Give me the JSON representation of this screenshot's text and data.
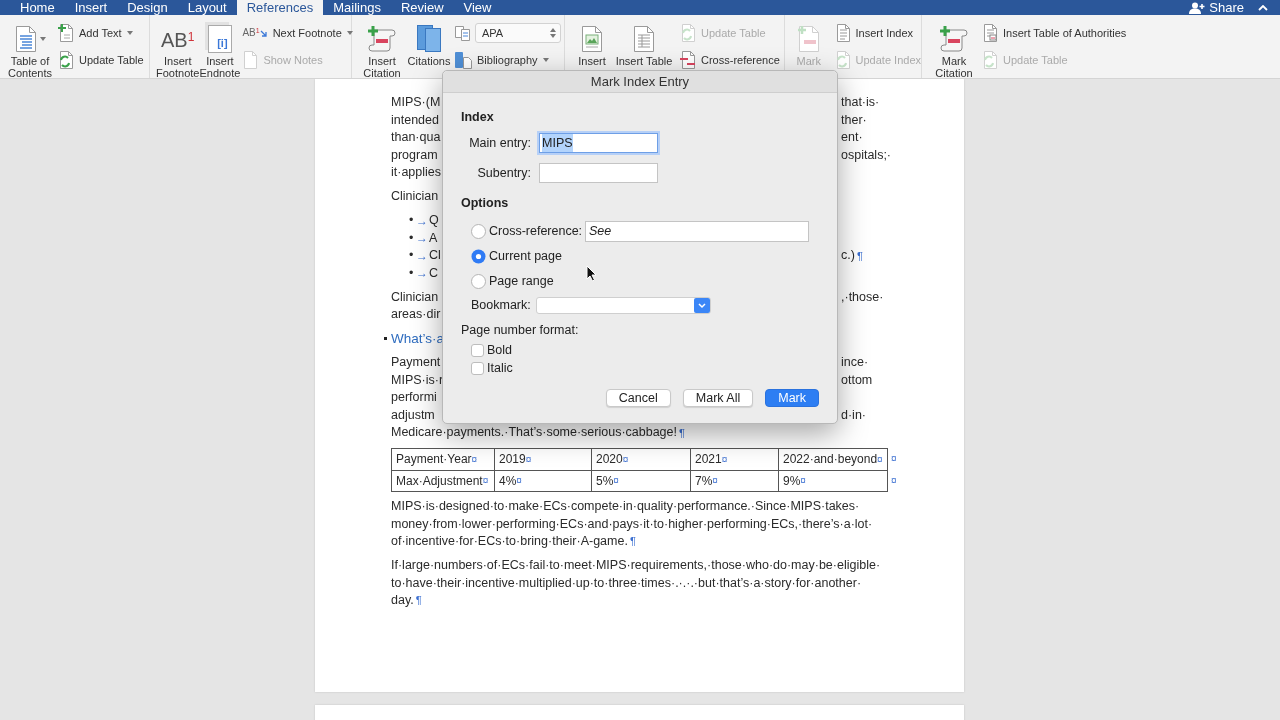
{
  "tabs": [
    {
      "label": "Home",
      "selected": false
    },
    {
      "label": "Insert",
      "selected": false
    },
    {
      "label": "Design",
      "selected": false
    },
    {
      "label": "Layout",
      "selected": false
    },
    {
      "label": "References",
      "selected": true
    },
    {
      "label": "Mailings",
      "selected": false
    },
    {
      "label": "Review",
      "selected": false
    },
    {
      "label": "View",
      "selected": false
    }
  ],
  "share": {
    "label": "Share"
  },
  "ribbon": [
    {
      "large": [
        {
          "lines": [
            "Table of",
            "Contents"
          ],
          "dropdown": true,
          "disabled": false
        }
      ],
      "small": [
        {
          "kind": "button",
          "label": "Add Text",
          "dropdown": true,
          "disabled": false
        },
        {
          "kind": "button",
          "label": "Update Table",
          "dropdown": false,
          "disabled": false
        }
      ]
    },
    {
      "large": [
        {
          "lines": [
            "Insert",
            "Footnote"
          ],
          "glyph": "AB",
          "glyph_sup": "1",
          "dropdown": false,
          "disabled": false
        },
        {
          "lines": [
            "Insert",
            "Endnote"
          ],
          "glyph": "[i]",
          "dropdown": false,
          "disabled": false
        }
      ],
      "small": [
        {
          "kind": "button",
          "label": "Next Footnote",
          "glyph": "AB",
          "glyph_sup": "1",
          "dropdown": true,
          "disabled": false
        },
        {
          "kind": "button",
          "label": "Show Notes",
          "dropdown": false,
          "disabled": true
        }
      ]
    },
    {
      "large": [
        {
          "lines": [
            "Insert",
            "Citation"
          ],
          "dropdown": false,
          "disabled": false
        },
        {
          "lines": [
            "Citations"
          ],
          "dropdown": false,
          "disabled": false
        }
      ],
      "small": [
        {
          "kind": "select",
          "value": "APA",
          "dropdown": false,
          "disabled": false
        },
        {
          "kind": "button",
          "label": "Bibliography",
          "dropdown": true,
          "disabled": false
        }
      ]
    },
    {
      "large": [
        {
          "lines": [
            "Insert"
          ],
          "dropdown": false,
          "disabled": false
        },
        {
          "lines": [
            "Insert Table"
          ],
          "dropdown": false,
          "disabled": false
        }
      ],
      "small": [
        {
          "kind": "button",
          "label": "Update Table",
          "dropdown": false,
          "disabled": true
        },
        {
          "kind": "button",
          "label": "Cross-reference",
          "dropdown": false,
          "disabled": false
        }
      ]
    },
    {
      "large": [
        {
          "lines": [
            "Mark"
          ],
          "dropdown": false,
          "disabled": true
        }
      ],
      "small": [
        {
          "kind": "button",
          "label": "Insert Index",
          "dropdown": false,
          "disabled": false
        },
        {
          "kind": "button",
          "label": "Update Index",
          "dropdown": false,
          "disabled": true
        }
      ]
    },
    {
      "large": [
        {
          "lines": [
            "Mark",
            "Citation"
          ],
          "dropdown": false,
          "disabled": false
        }
      ],
      "small": [
        {
          "kind": "button",
          "label": "Insert Table of Authorities",
          "dropdown": false,
          "disabled": false
        },
        {
          "kind": "button",
          "label": "Update Table",
          "dropdown": false,
          "disabled": true
        }
      ]
    }
  ],
  "document": {
    "blocks": [
      {
        "kind": "fragment",
        "lines": [
          {
            "left": "MIPS·(M",
            "right": "that·is·"
          },
          {
            "left": "intended",
            "right": "ther·"
          },
          {
            "left": "than·qua",
            "right": "ent·"
          },
          {
            "left": "program",
            "right": "ospitals;·"
          },
          {
            "left": "it·applies"
          }
        ]
      },
      {
        "kind": "fragment",
        "lines": [
          {
            "left": "Clinician"
          }
        ]
      },
      {
        "kind": "bullets",
        "items": [
          {
            "bullet": "•",
            "tab": "→",
            "left": "Q"
          },
          {
            "bullet": "•",
            "tab": "→",
            "left": "A"
          },
          {
            "bullet": "•",
            "tab": "→",
            "left": "Cl",
            "right": "c.)",
            "mark": "¶"
          },
          {
            "bullet": "•",
            "tab": "→",
            "left": "C"
          }
        ]
      },
      {
        "kind": "fragment",
        "lines": [
          {
            "left": "Clinician",
            "right": ",·those·"
          },
          {
            "left": "areas·dir"
          }
        ]
      },
      {
        "kind": "heading",
        "lines": [
          {
            "left": "What’s·a"
          }
        ]
      },
      {
        "kind": "fragment",
        "lines": [
          {
            "left": "Payment",
            "right": "ince·"
          },
          {
            "left": "MIPS·is·r",
            "right": "ottom"
          },
          {
            "left": "performi"
          },
          {
            "left": "adjustm",
            "right": "d·in·"
          },
          {
            "left": "Medicare·payments.·That’s·some·serious·cabbage!",
            "mark": "¶"
          }
        ]
      },
      {
        "kind": "table",
        "rows": [
          {
            "cells": [
              {
                "text": "Payment·Year",
                "mark": "¤"
              },
              {
                "text": "2019",
                "mark": "¤"
              },
              {
                "text": "2020",
                "mark": "¤"
              },
              {
                "text": "2021",
                "mark": "¤"
              },
              {
                "text": "2022·and·beyond",
                "mark": "¤"
              }
            ],
            "row_mark": "¤"
          },
          {
            "cells": [
              {
                "text": "Max·Adjustment",
                "mark": "¤"
              },
              {
                "text": "4%",
                "mark": "¤"
              },
              {
                "text": "5%",
                "mark": "¤"
              },
              {
                "text": "7%",
                "mark": "¤"
              },
              {
                "text": "9%",
                "mark": "¤"
              }
            ],
            "row_mark": "¤"
          }
        ]
      },
      {
        "kind": "paragraph",
        "lines": [
          "MIPS·is·designed·to·make·ECs·compete·in·quality·performance.·Since·MIPS·takes·",
          "money·from·lower·performing·ECs·and·pays·it·to·higher·performing·ECs,·there’s·a·lot·",
          "of·incentive·for·ECs·to·bring·their·A-game."
        ],
        "mark": "¶"
      },
      {
        "kind": "paragraph",
        "lines": [
          "If·large·numbers·of·ECs·fail·to·meet·MIPS·requirements,·those·who·do·may·be·eligible·",
          "to·have·their·incentive·multiplied·up·to·three·times·.·.·.·but·that’s·a·story·for·another·",
          "day."
        ],
        "mark": "¶"
      }
    ]
  },
  "dialog": {
    "title": "Mark Index Entry",
    "index": {
      "heading": "Index",
      "main_entry": {
        "label": "Main entry:",
        "value": "MIPS",
        "text_selected": true,
        "focused": true
      },
      "subentry": {
        "label": "Subentry:",
        "focused": false
      }
    },
    "options": {
      "heading": "Options",
      "choices": [
        {
          "kind": "field",
          "label": "Cross-reference:",
          "value": "See",
          "selected": false
        },
        {
          "kind": "plain",
          "label": "Current page",
          "selected": true
        },
        {
          "kind": "plain",
          "label": "Page range",
          "selected": false
        }
      ],
      "bookmark": {
        "label": "Bookmark:"
      }
    },
    "page_number_format": {
      "label": "Page number format:",
      "options": [
        {
          "label": "Bold",
          "checked": false
        },
        {
          "label": "Italic",
          "checked": false
        }
      ]
    },
    "buttons": [
      {
        "label": "Cancel",
        "default": false
      },
      {
        "label": "Mark All",
        "default": false
      },
      {
        "label": "Mark",
        "default": true
      }
    ]
  }
}
